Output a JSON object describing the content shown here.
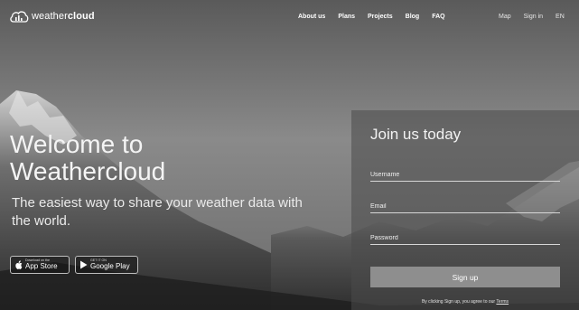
{
  "brand": {
    "name_light": "weather",
    "name_bold": "cloud"
  },
  "nav": {
    "links": [
      "About us",
      "Plans",
      "Projects",
      "Blog",
      "FAQ"
    ],
    "right": [
      "Map",
      "Sign in",
      "EN"
    ]
  },
  "hero": {
    "title": "Welcome to Weathercloud",
    "subtitle": "The easiest way to share your weather data with the world."
  },
  "stores": {
    "apple": {
      "small": "Download on the",
      "big": "App Store",
      "icon": "apple-icon"
    },
    "google": {
      "small": "GET IT ON",
      "big": "Google Play",
      "icon": "play-icon"
    }
  },
  "form": {
    "title": "Join us today",
    "username_placeholder": "Username",
    "email_placeholder": "Email",
    "password_placeholder": "Password",
    "submit_label": "Sign up",
    "terms_prefix": "By clicking Sign up, you agree to our",
    "terms_link": "Terms"
  },
  "colors": {
    "panel": "#4b4b4b",
    "button": "#8e8e8e",
    "text": "#ffffff"
  }
}
